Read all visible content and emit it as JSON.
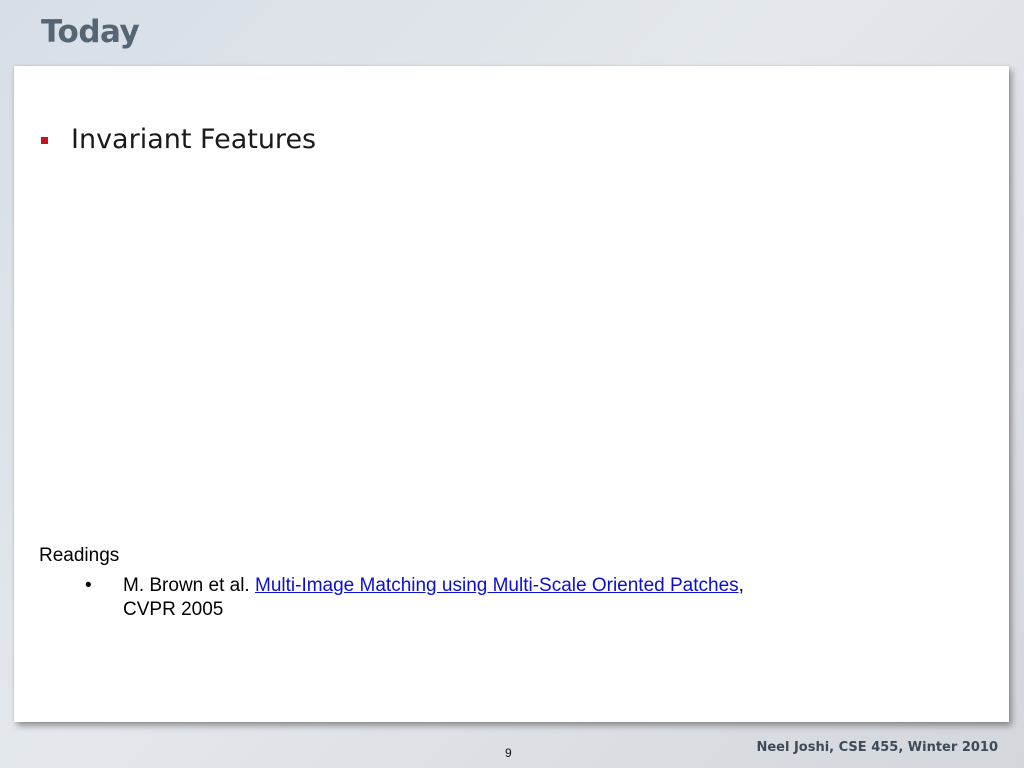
{
  "slide": {
    "title": "Today",
    "bullets": [
      {
        "text": "Invariant Features"
      }
    ],
    "readings": {
      "heading": "Readings",
      "items": [
        {
          "bullet_glyph": "•",
          "authors": "M. Brown et al. ",
          "link_text": "Multi-Image Matching using Multi-Scale Oriented Patches",
          "after_link": ",",
          "venue": "CVPR 2005"
        }
      ]
    }
  },
  "footer": {
    "page_number": "9",
    "credit": "Neel Joshi, CSE 455, Winter 2010"
  },
  "colors": {
    "bullet_accent": "#c0171e",
    "link": "#0b0fd4",
    "title": "#566573"
  }
}
